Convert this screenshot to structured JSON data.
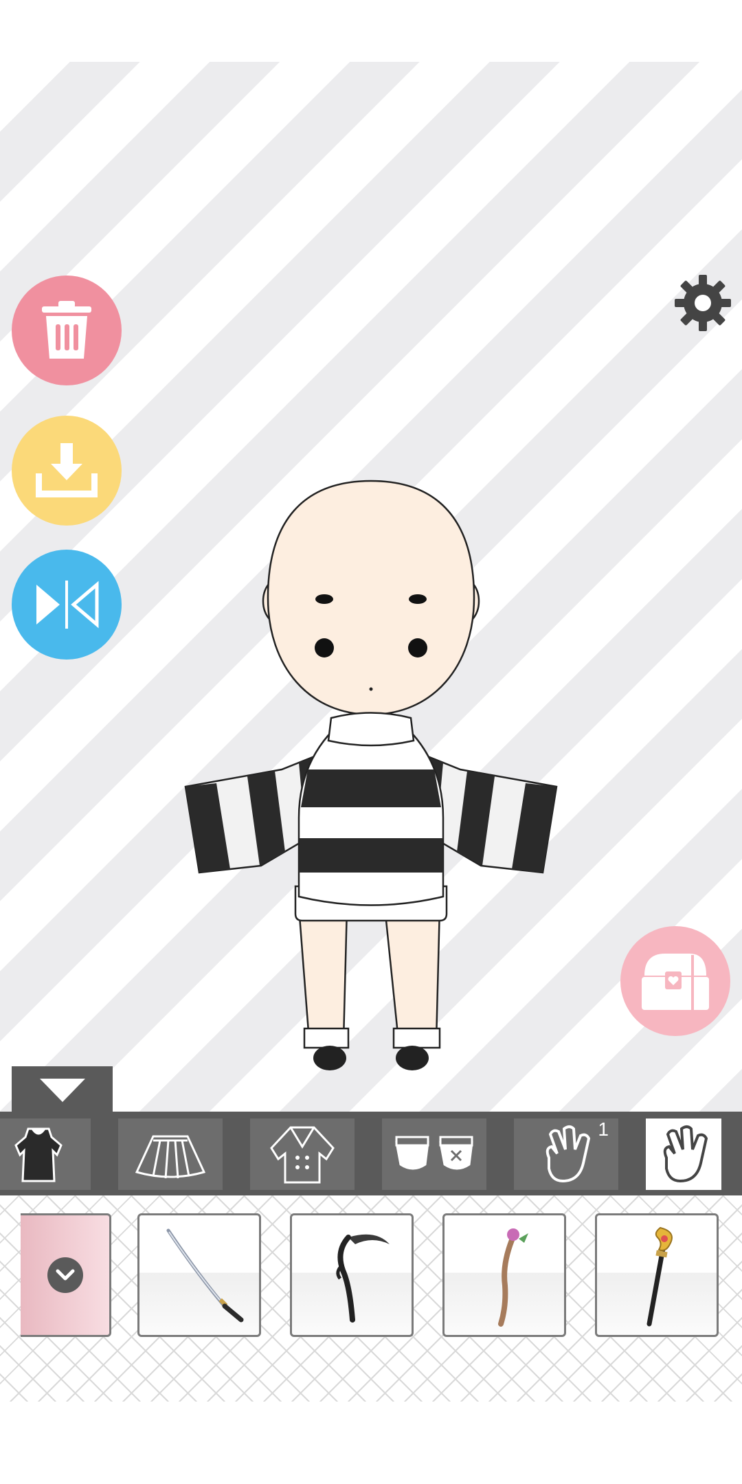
{
  "app": {
    "screen": "character-editor"
  },
  "left_buttons": [
    {
      "icon": "trash-icon",
      "color": "#f0909f"
    },
    {
      "icon": "download-icon",
      "color": "#fbd979"
    },
    {
      "icon": "mirror-flip-icon",
      "color": "#49b9ec"
    }
  ],
  "right_buttons": [
    {
      "icon": "gear-icon",
      "color": "#444444"
    },
    {
      "icon": "treasure-chest-icon",
      "color": "#f7b6c0"
    }
  ],
  "panel_toggle": {
    "icon": "triangle-down-icon"
  },
  "categories": [
    {
      "icon": "dress-icon",
      "active": false
    },
    {
      "icon": "skirt-icon",
      "active": false
    },
    {
      "icon": "coat-icon",
      "active": false
    },
    {
      "icon": "socks-icon",
      "active": false
    },
    {
      "icon": "hand-item-icon",
      "active": false,
      "badge": "1"
    },
    {
      "icon": "hand-item-icon",
      "active": true
    }
  ],
  "items": [
    {
      "icon": "check-icon",
      "selected": true
    },
    {
      "icon": "katana-icon"
    },
    {
      "icon": "scythe-icon"
    },
    {
      "icon": "flower-staff-icon"
    },
    {
      "icon": "gold-staff-icon"
    }
  ],
  "colors": {
    "bar": "#5a5a5a",
    "stripe_light": "#ffffff",
    "stripe_dark": "#ececee",
    "selected_item": "#f4c9d0"
  }
}
